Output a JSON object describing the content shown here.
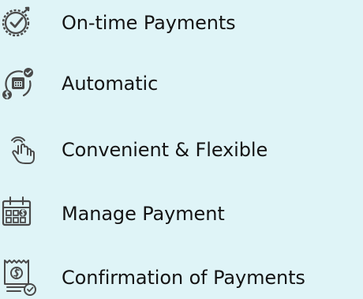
{
  "features": {
    "items": [
      {
        "label": "On-time Payments",
        "icon": "clock-check-icon"
      },
      {
        "label": "Automatic",
        "icon": "calendar-autopay-icon"
      },
      {
        "label": "Convenient & Flexible",
        "icon": "touch-hand-icon"
      },
      {
        "label": "Manage Payment",
        "icon": "calendar-dollar-icon"
      },
      {
        "label": "Confirmation of Payments",
        "icon": "receipt-check-icon"
      }
    ]
  },
  "colors": {
    "background": "#dff4f7",
    "icon_stroke": "#4a4a4a",
    "text": "#141414"
  }
}
